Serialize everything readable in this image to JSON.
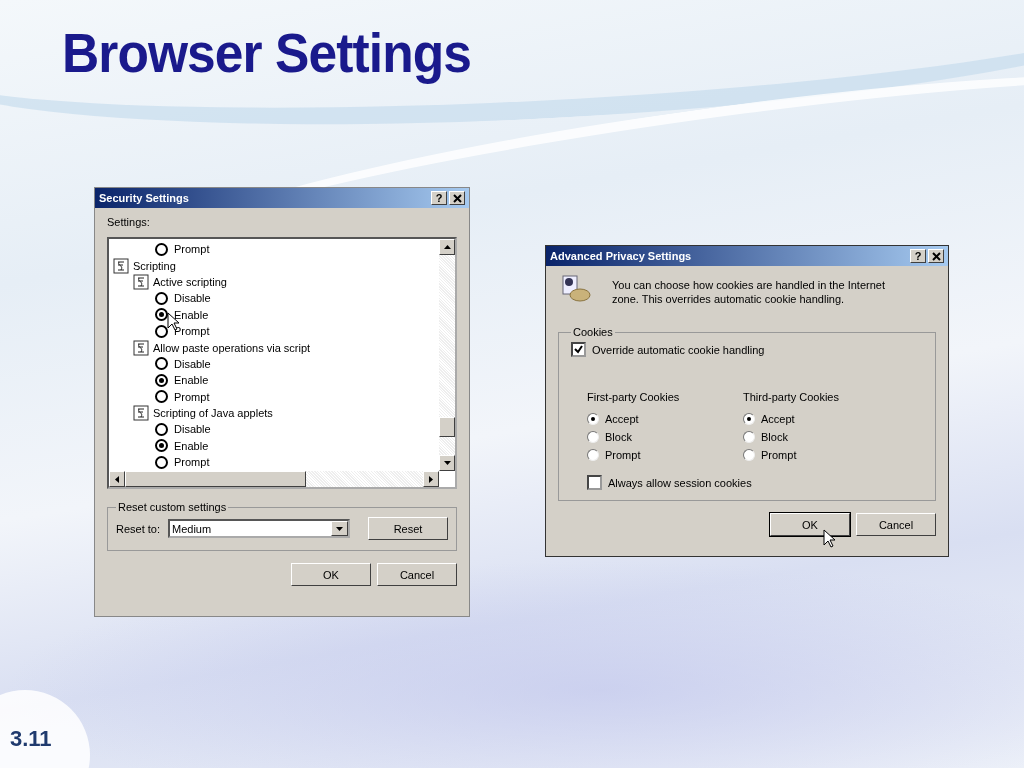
{
  "slide": {
    "title": "Browser Settings",
    "page_number": "3.11"
  },
  "security_window": {
    "title": "Security Settings",
    "help": "?",
    "settings_label": "Settings:",
    "tree": [
      {
        "kind": "radio",
        "label": "Prompt",
        "selected": false
      },
      {
        "kind": "group",
        "label": "Scripting",
        "children": [
          {
            "kind": "group",
            "label": "Active scripting",
            "children": [
              {
                "kind": "radio",
                "label": "Disable",
                "selected": false
              },
              {
                "kind": "radio",
                "label": "Enable",
                "selected": true
              },
              {
                "kind": "radio",
                "label": "Prompt",
                "selected": false
              }
            ]
          },
          {
            "kind": "group",
            "label": "Allow paste operations via script",
            "children": [
              {
                "kind": "radio",
                "label": "Disable",
                "selected": false
              },
              {
                "kind": "radio",
                "label": "Enable",
                "selected": true
              },
              {
                "kind": "radio",
                "label": "Prompt",
                "selected": false
              }
            ]
          },
          {
            "kind": "group",
            "label": "Scripting of Java applets",
            "children": [
              {
                "kind": "radio",
                "label": "Disable",
                "selected": false
              },
              {
                "kind": "radio",
                "label": "Enable",
                "selected": true
              },
              {
                "kind": "radio",
                "label": "Prompt",
                "selected": false
              }
            ]
          }
        ]
      }
    ],
    "reset_group": {
      "legend": "Reset custom settings",
      "label": "Reset to:",
      "value": "Medium",
      "button": "Reset"
    },
    "buttons": [
      "OK",
      "Cancel"
    ]
  },
  "privacy_window": {
    "title": "Advanced Privacy Settings",
    "help": "?",
    "description": "You can choose how cookies are handled in the Internet zone.  This overrides automatic cookie handling.",
    "cookies_group": {
      "legend": "Cookies",
      "override": {
        "label": "Override automatic cookie handling",
        "checked": true
      },
      "columns": [
        {
          "heading": "First-party Cookies",
          "options": [
            {
              "label": "Accept",
              "selected": true
            },
            {
              "label": "Block",
              "selected": false
            },
            {
              "label": "Prompt",
              "selected": false
            }
          ]
        },
        {
          "heading": "Third-party Cookies",
          "options": [
            {
              "label": "Accept",
              "selected": true
            },
            {
              "label": "Block",
              "selected": false
            },
            {
              "label": "Prompt",
              "selected": false
            }
          ]
        }
      ],
      "session": {
        "label": "Always allow session cookies",
        "checked": false
      }
    },
    "buttons": [
      "OK",
      "Cancel"
    ]
  }
}
